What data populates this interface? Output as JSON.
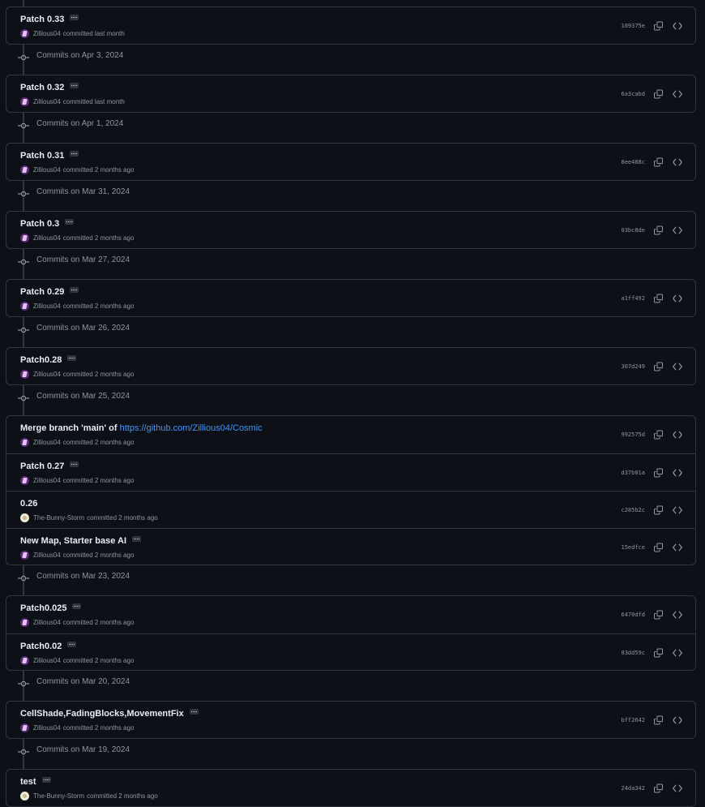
{
  "groups": [
    {
      "date": null,
      "commits": [
        {
          "title": "Patch 0.33",
          "has_more": true,
          "author": "Zillious04",
          "avatar": "zillious",
          "time": "committed last month",
          "sha": "109375e"
        }
      ]
    },
    {
      "date": "Commits on Apr 3, 2024",
      "commits": [
        {
          "title": "Patch 0.32",
          "has_more": true,
          "author": "Zillious04",
          "avatar": "zillious",
          "time": "committed last month",
          "sha": "6a3cabd"
        }
      ]
    },
    {
      "date": "Commits on Apr 1, 2024",
      "commits": [
        {
          "title": "Patch 0.31",
          "has_more": true,
          "author": "Zillious04",
          "avatar": "zillious",
          "time": "committed 2 months ago",
          "sha": "8ee488c"
        }
      ]
    },
    {
      "date": "Commits on Mar 31, 2024",
      "commits": [
        {
          "title": "Patch 0.3",
          "has_more": true,
          "author": "Zillious04",
          "avatar": "zillious",
          "time": "committed 2 months ago",
          "sha": "03bc8de"
        }
      ]
    },
    {
      "date": "Commits on Mar 27, 2024",
      "commits": [
        {
          "title": "Patch 0.29",
          "has_more": true,
          "author": "Zillious04",
          "avatar": "zillious",
          "time": "committed 2 months ago",
          "sha": "a1ff492"
        }
      ]
    },
    {
      "date": "Commits on Mar 26, 2024",
      "commits": [
        {
          "title": "Patch0.28",
          "has_more": true,
          "author": "Zillious04",
          "avatar": "zillious",
          "time": "committed 2 months ago",
          "sha": "307d249"
        }
      ]
    },
    {
      "date": "Commits on Mar 25, 2024",
      "commits": [
        {
          "title": "Merge branch 'main' of ",
          "link": "https://github.com/Zillious04/Cosmic",
          "has_more": false,
          "author": "Zillious04",
          "avatar": "zillious",
          "time": "committed 2 months ago",
          "sha": "992575d"
        },
        {
          "title": "Patch 0.27",
          "has_more": true,
          "author": "Zillious04",
          "avatar": "zillious",
          "time": "committed 2 months ago",
          "sha": "d37b01a"
        },
        {
          "title": "0.26",
          "has_more": false,
          "author": "The-Bunny-Storm",
          "avatar": "bunny",
          "time": "committed 2 months ago",
          "sha": "c285b2c"
        },
        {
          "title": "New Map, Starter base AI",
          "has_more": true,
          "author": "Zillious04",
          "avatar": "zillious",
          "time": "committed 2 months ago",
          "sha": "15edfce"
        }
      ]
    },
    {
      "date": "Commits on Mar 23, 2024",
      "commits": [
        {
          "title": "Patch0.025",
          "has_more": true,
          "author": "Zillious04",
          "avatar": "zillious",
          "time": "committed 2 months ago",
          "sha": "6470dfd"
        },
        {
          "title": "Patch0.02",
          "has_more": true,
          "author": "Zillious04",
          "avatar": "zillious",
          "time": "committed 2 months ago",
          "sha": "03dd59c"
        }
      ]
    },
    {
      "date": "Commits on Mar 20, 2024",
      "commits": [
        {
          "title": "CellShade,FadingBlocks,MovementFix",
          "has_more": true,
          "author": "Zillious04",
          "avatar": "zillious",
          "time": "committed 2 months ago",
          "sha": "bff2642"
        }
      ]
    },
    {
      "date": "Commits on Mar 19, 2024",
      "commits": [
        {
          "title": "test",
          "has_more": true,
          "author": "The-Bunny-Storm",
          "avatar": "bunny",
          "time": "committed 2 months ago",
          "sha": "24da342"
        }
      ]
    }
  ]
}
